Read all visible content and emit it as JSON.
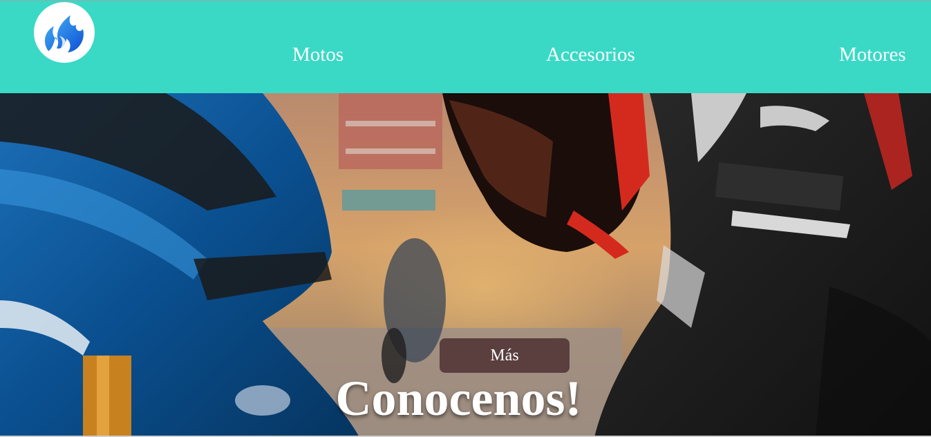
{
  "header": {
    "logo_icon": "blue-flame-logo-icon",
    "background": "#3ad9c6",
    "nav": [
      {
        "label": "Motos"
      },
      {
        "label": "Accesorios"
      },
      {
        "label": "Motores"
      }
    ]
  },
  "hero": {
    "background_image": "motorcycle-and-rider-photo",
    "title": "Conocenos!",
    "button_label": "Más",
    "button_color": "#5a3f3e"
  }
}
